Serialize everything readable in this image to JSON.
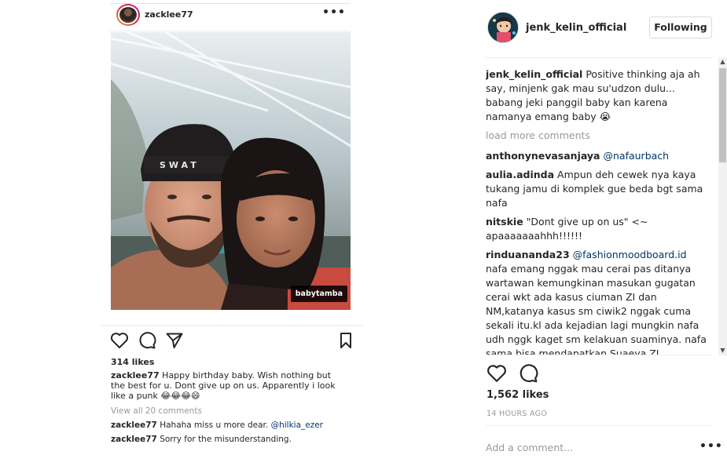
{
  "embedded_post": {
    "username": "zacklee77",
    "more_glyph": "•••",
    "photo_tag": "babytamba",
    "cap_text": "SWAT",
    "likes": "314 likes",
    "caption_user": "zacklee77",
    "caption_text": "Happy birthday baby. Wish nothing but the best for u. Dont give up on us. Apparently i look like a punk 😂😂😂😄",
    "view_all": "View all 20 comments",
    "comments": [
      {
        "user": "zacklee77",
        "text": "Hahaha miss u more dear. ",
        "mention": "@hilkia_ezer"
      },
      {
        "user": "zacklee77",
        "text": "Sorry for the misunderstanding.",
        "mention": ""
      }
    ]
  },
  "side_panel": {
    "username": "jenk_kelin_official",
    "follow_button": "Following",
    "caption_user": "jenk_kelin_official",
    "caption_text": "Positive thinking aja ah say, minjenk gak mau su'udzon dulu... babang jeki panggil baby kan karena namanya emang baby 😭",
    "load_more": "load more comments",
    "comments": [
      {
        "user": "anthonynevasanjaya",
        "text": "",
        "mention": "@nafaurbach"
      },
      {
        "user": "aulia.adinda",
        "text": "Ampun deh cewek nya kaya tukang jamu di komplek gue beda bgt sama nafa",
        "mention": ""
      },
      {
        "user": "nitskie",
        "text": "\"Dont give up on us\" <~ apaaaaaaahhh!!!!!!",
        "mention": ""
      },
      {
        "user": "rinduananda23",
        "text": "nafa emang nggak mau cerai pas ditanya wartawan kemungkinan masukan gugatan cerai wkt ada kasus ciuman ZI dan NM,katanya kasus sm ciwik2 nggak cuma sekali itu.kl ada kejadian lagi mungkin nafa udh nggk kaget sm kelakuan suaminya. nafa sama bisa mendapatkan Suaeya ZI",
        "mention": "@fashionmoodboard.id"
      }
    ],
    "likes": "1,562 likes",
    "timestamp": "14 HOURS AGO",
    "add_comment_placeholder": "Add a comment...",
    "more_glyph": "•••"
  },
  "colors": {
    "text": "#262626",
    "muted": "#999999",
    "mention": "#003569",
    "border": "#dbdbdb"
  },
  "icons": [
    "heart-icon",
    "comment-icon",
    "share-icon",
    "bookmark-icon",
    "more-icon"
  ]
}
